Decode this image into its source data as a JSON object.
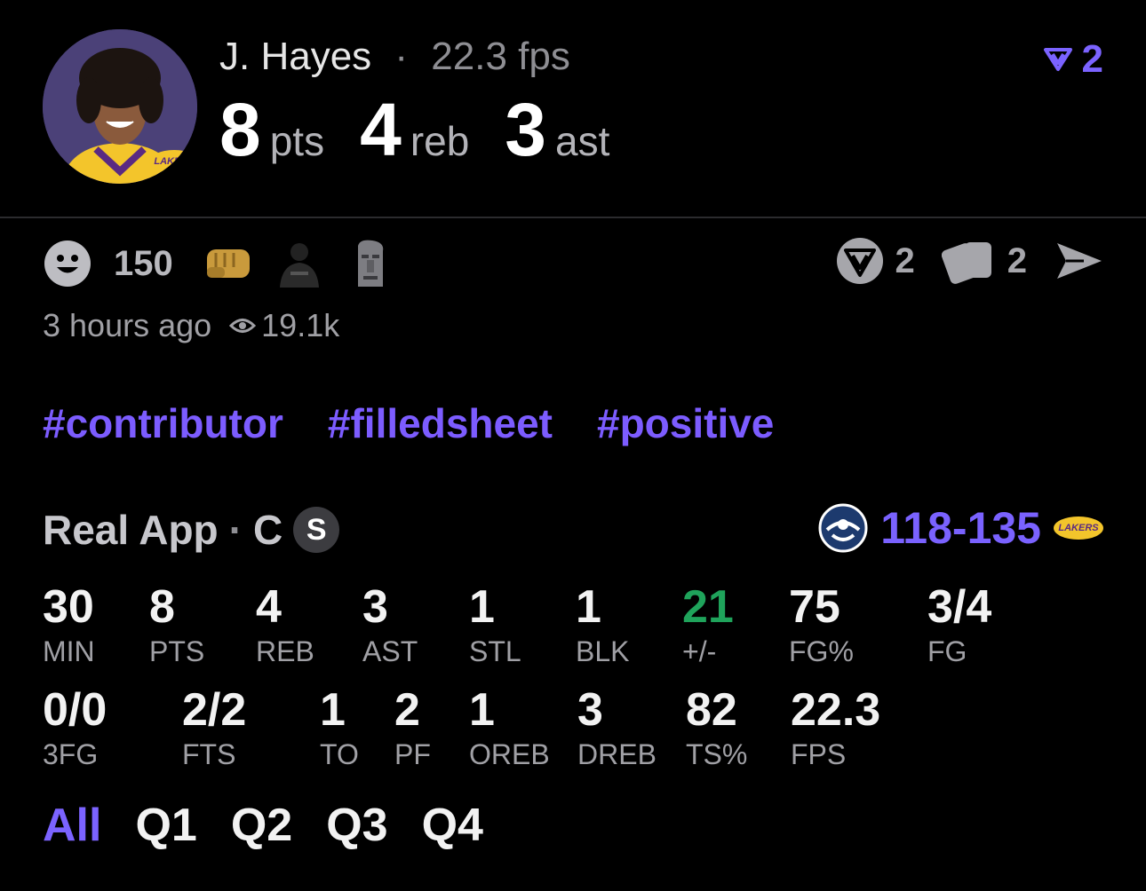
{
  "header": {
    "player_name": "J. Hayes",
    "separator": "·",
    "fps_text": "22.3 fps",
    "headline": [
      {
        "value": "8",
        "unit": "pts"
      },
      {
        "value": "4",
        "unit": "reb"
      },
      {
        "value": "3",
        "unit": "ast"
      }
    ],
    "vote_count": "2",
    "team_logo_text": "LAKERS"
  },
  "reactions": {
    "count": "150",
    "emojis": [
      "smiley-icon",
      "fist-bump-icon",
      "nets-player-icon",
      "moai-icon"
    ]
  },
  "actions": {
    "vote_count": "2",
    "cards_count": "2"
  },
  "meta": {
    "time_ago": "3 hours ago",
    "views": "19.1k"
  },
  "tags": [
    "#contributor",
    "#filledsheet",
    "#positive"
  ],
  "game": {
    "source": "Real App",
    "separator": "·",
    "position": "C",
    "starter_badge": "S",
    "score": "118-135"
  },
  "stats_row1": [
    {
      "value": "30",
      "label": "MIN"
    },
    {
      "value": "8",
      "label": "PTS"
    },
    {
      "value": "4",
      "label": "REB"
    },
    {
      "value": "3",
      "label": "AST"
    },
    {
      "value": "1",
      "label": "STL"
    },
    {
      "value": "1",
      "label": "BLK"
    },
    {
      "value": "21",
      "label": "+/-"
    },
    {
      "value": "75",
      "label": "FG%"
    },
    {
      "value": "3/4",
      "label": "FG"
    }
  ],
  "stats_row2": [
    {
      "value": "0/0",
      "label": "3FG"
    },
    {
      "value": "2/2",
      "label": "FTS"
    },
    {
      "value": "1",
      "label": "TO"
    },
    {
      "value": "2",
      "label": "PF"
    },
    {
      "value": "1",
      "label": "OREB"
    },
    {
      "value": "3",
      "label": "DREB"
    },
    {
      "value": "82",
      "label": "TS%"
    },
    {
      "value": "22.3",
      "label": "FPS"
    }
  ],
  "tabs": [
    "All",
    "Q1",
    "Q2",
    "Q3",
    "Q4"
  ],
  "colors": {
    "accent": "#7b63ff",
    "positive": "#1fa35b",
    "background": "#000000"
  }
}
